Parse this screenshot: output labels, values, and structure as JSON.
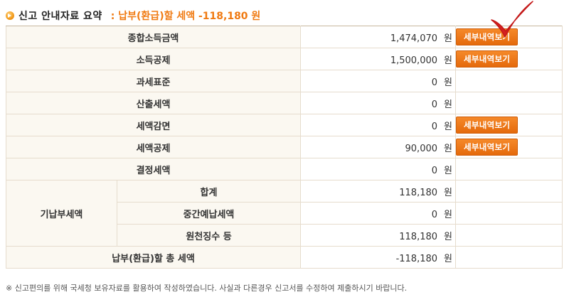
{
  "header": {
    "title": "신고 안내자료 요약",
    "result": ": 납부(환급)할 세액 -118,180 원"
  },
  "unit": "원",
  "detail_label": "세부내역보기",
  "rows": [
    {
      "label": "종합소득금액",
      "amount": "1,474,070"
    },
    {
      "label": "소득공제",
      "amount": "1,500,000"
    },
    {
      "label": "과세표준",
      "amount": "0"
    },
    {
      "label": "산출세액",
      "amount": "0"
    },
    {
      "label": "세액감면",
      "amount": "0"
    },
    {
      "label": "세액공제",
      "amount": "90,000"
    },
    {
      "label": "결정세액",
      "amount": "0"
    }
  ],
  "prepaid": {
    "group_label": "기납부세액",
    "rows": [
      {
        "label": "합계",
        "amount": "118,180"
      },
      {
        "label": "중간예납세액",
        "amount": "0"
      },
      {
        "label": "원천징수 등",
        "amount": "118,180"
      }
    ]
  },
  "total": {
    "label": "납부(환급)할 총 세액",
    "amount": "-118,180"
  },
  "footnote": "※ 신고편의를 위해 국세청 보유자료를 활용하여 작성하였습니다. 사실과 다른경우 신고서를 수정하여 제출하시기 바랍니다.",
  "colors": {
    "accent": "#f07a12",
    "button": "#e86f10",
    "check": "#d42020",
    "label_bg": "#fbf8f1"
  }
}
